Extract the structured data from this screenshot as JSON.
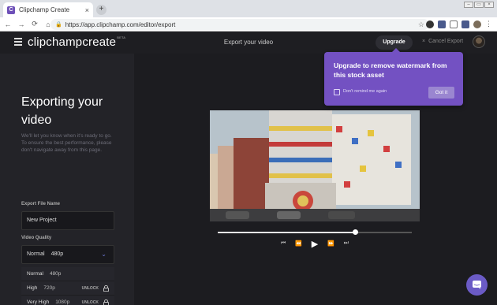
{
  "browser": {
    "tab_title": "Clipchamp Create",
    "tab_close": "×",
    "newtab": "+",
    "url": "https://app.clipchamp.com/editor/export",
    "back": "←",
    "forward": "→",
    "reload": "⟳",
    "home": "⌂",
    "secure": "🔒",
    "star": "☆",
    "menu": "⋮",
    "window_minimize": "–",
    "window_restore": "▭",
    "window_close": "×"
  },
  "app": {
    "logo": "clipchampcreate",
    "logo_badge": "BETA",
    "title": "Export your video",
    "upgrade_label": "Upgrade",
    "cancel_label": "Cancel Export",
    "cancel_x": "×"
  },
  "exporting": {
    "heading": "Exporting your video",
    "subtext": "We'll let you know when it's ready to go.\nTo ensure the best performance, please don't navigate away from this page."
  },
  "form": {
    "file_name_label": "Export File Name",
    "file_name_value": "New Project",
    "quality_label": "Video Quality",
    "quality_selected": "Normal",
    "quality_selected_res": "480p",
    "chevron": "⌄",
    "options": [
      {
        "label": "Normal",
        "res": "480p",
        "unlock": ""
      },
      {
        "label": "High",
        "res": "720p",
        "unlock": "UNLOCK"
      },
      {
        "label": "Very High",
        "res": "1080p",
        "unlock": "UNLOCK"
      }
    ]
  },
  "player": {
    "progress": 0.71,
    "controls": [
      "⏮",
      "⏪",
      "▶",
      "⏩",
      "⏭"
    ]
  },
  "popover": {
    "title": "Upgrade to remove watermark from this stock asset",
    "checkbox_label": "Don't remind me again",
    "button_label": "Got it"
  },
  "colors": {
    "accent": "#7351c2",
    "background": "#1c1c20"
  }
}
